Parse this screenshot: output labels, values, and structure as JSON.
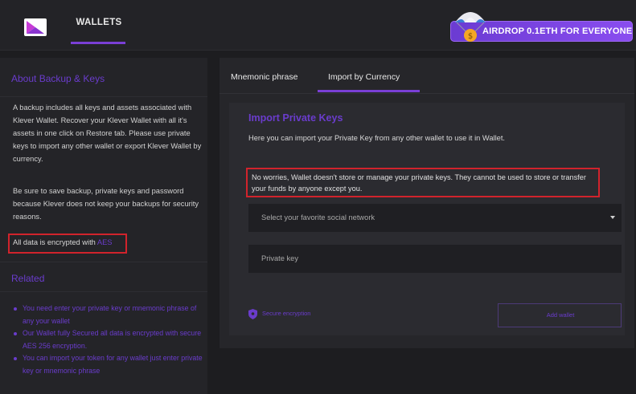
{
  "header": {
    "nav_label": "WALLETS",
    "airdrop_label": "AIRDROP 0.1ETH FOR EVERYONE"
  },
  "left_panel": {
    "title": "About Backup & Keys",
    "paragraph1": "A backup includes all keys and assets associated with Klever Wallet. Recover your Klever Wallet with all it's assets in one click on Restore tab. Please use private keys to import any other wallet or export Klever Wallet by currency.",
    "paragraph2": "Be sure to save backup, private keys and password because Klever does not keep your backups for security reasons.",
    "encrypted_prefix": "All data is encrypted with ",
    "encrypted_link": "AES",
    "related_title": "Related",
    "related_items": [
      "You need enter your private key or mnemonic phrase of any your wallet",
      "Our Wallet fully Secured all data is encrypted with secure AES 256 encryption.",
      "You can import your token for any wallet just enter private key or mnemonic phrase"
    ]
  },
  "tabs": [
    {
      "label": "Mnemonic phrase"
    },
    {
      "label": "Import by Currency"
    }
  ],
  "import_card": {
    "title": "Import Private Keys",
    "subtitle": "Here you can import your Private Key from any other wallet to use it in Wallet.",
    "notice": "No worries, Wallet doesn't store or manage your private keys. They cannot be used to store or transfer your funds by anyone except you.",
    "select_value": "Select your favorite social network",
    "private_key_placeholder": "Private key",
    "secure_label": "Secure encryption",
    "add_button_label": "Add wallet"
  },
  "colors": {
    "accent": "#7a3fd6",
    "accent_text": "#6a3ccc",
    "highlight_border": "#d1232c",
    "background": "#1d1d20"
  },
  "icons": {
    "logo": "wallet-logo-icon",
    "airdrop": "parachute-icon",
    "secure": "shield-icon",
    "dropdown": "caret-down-icon"
  }
}
